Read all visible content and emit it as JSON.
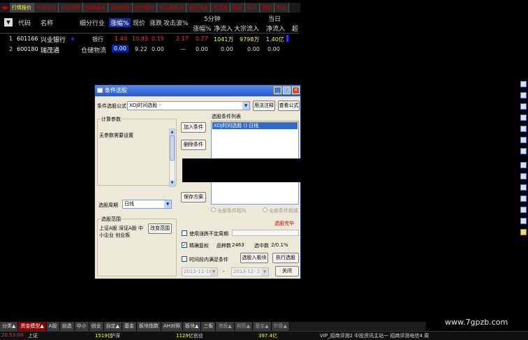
{
  "top_tabs": {
    "arrows": "◀▶",
    "tabs": [
      "行情报价",
      "资金驱动",
      "资金博弈",
      "DDE排名",
      "多空阵线",
      "SUP统计",
      "方正股票池",
      "潜伏热点",
      "关注度",
      "报表",
      "板区",
      "市场",
      "资金"
    ]
  },
  "table": {
    "headers": {
      "selector": "▼",
      "code": "代码",
      "name": "名称",
      "industry": "细分行业",
      "change_pct": "涨幅%",
      "price": "现价",
      "change": "涨跌",
      "attack": "攻击波%",
      "five_min": "5分钟",
      "five_min_change": "涨幅%",
      "net_inflow": "净流入",
      "bulk_inflow": "大宗流入",
      "today": "当日",
      "today_net": "净流入",
      "super": "超"
    },
    "rows": [
      {
        "idx": "1",
        "code": "601166",
        "name": "兴业银行",
        "flag": "R",
        "industry": "银行",
        "change_pct": "1.40",
        "price": "10.85",
        "change": "0.15",
        "attack": "2.17",
        "five_min_change": "0.27",
        "net_inflow": "1041万",
        "bulk_inflow": "9798万",
        "today_net": "1.40亿"
      },
      {
        "idx": "2",
        "code": "600180",
        "name": "瑞茂通",
        "flag": "",
        "industry": "仓储物流",
        "change_pct": "0.00",
        "price": "9.22",
        "change": "0.00",
        "attack": "—",
        "five_min_change": "0.00",
        "net_inflow": "0.00",
        "bulk_inflow": "0.00",
        "today_net": "0.00"
      }
    ]
  },
  "dialog": {
    "title": "条件选股",
    "formula_label": "条件选股公式",
    "formula_value": "XDJ时间选股 -",
    "btn_usage": "用法注释",
    "btn_view": "查看公式",
    "params_group": "计算参数",
    "params_text": "无参数需要设置",
    "btn_add": "加入条件",
    "btn_delete": "删除条件",
    "btn_save": "保存方案",
    "list_label": "选股条件列表",
    "list_items": [
      "XDJ时间选股  ()  日线"
    ],
    "period_label": "选股周期",
    "period_value": "日线",
    "radio_all": "全部条件相与",
    "radio_any": "全部条件相或",
    "status": "选股完毕",
    "scope_group": "选股范围",
    "scope_text_line1": "上证A股 深证A股 中",
    "scope_text_line2": "小企业 创业板",
    "btn_scope": "改变范围",
    "chk_uncertain": "使用涨跌不定周期",
    "chk_precise": "精确复权",
    "count_label": "品种数",
    "count_value": "2463",
    "selected_label": "选中数",
    "selected_value": "2/0.1%",
    "chk_time": "时间段内满足条件",
    "btn_to_block": "选股入板块",
    "btn_execute": "执行选股",
    "date_from": "2013-11-18",
    "date_sep": "-",
    "date_to": "2013-12- 2",
    "btn_close": "关闭"
  },
  "right_bar_icons": [
    "chart-icon",
    "fx-icon",
    "list-icon",
    "grid-icon",
    "doc-icon",
    "calc-icon",
    "zoom-icon",
    "folder-icon",
    "compare-icon",
    "alert-icon",
    "tool-icon",
    "export-icon",
    "lock-icon",
    "star-icon"
  ],
  "bottom_tabs": [
    "分类▲",
    "资金模型▲",
    "A股",
    "自选",
    "中小",
    "创业",
    "自定▲",
    "基金",
    "板块指数",
    "AH对照",
    "板块▲",
    "三板",
    "港股▲",
    "期货▲",
    "基金▲",
    "外盘▲"
  ],
  "status": {
    "time": "20:53:00",
    "sh_label": "上证",
    "sh_value": "1519亿",
    "sz_label": "沪深",
    "sz_value": "1129亿",
    "cy_label": "创业",
    "cy_value": "397.4亿",
    "news": "VIP_招商评测2 中投资讯主站一 招商评测电信4 周"
  },
  "watermark": "www.7gpzb.com",
  "colors": {
    "accent_red": "#cc0000",
    "up_red": "#ff3333",
    "up_yellow": "#ffff33",
    "highlight_blue": "#0a24a0",
    "code_white": "#ffffff"
  }
}
